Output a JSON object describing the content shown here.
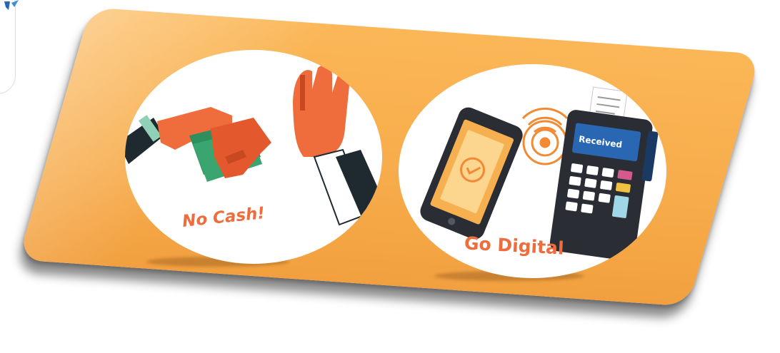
{
  "panels": {
    "left": {
      "caption": "No Cash!"
    },
    "right": {
      "caption": "Go Digital",
      "terminal_screen_text": "Received"
    }
  },
  "colors": {
    "card": "#f7ab4a",
    "accent_orange": "#ef6d3c",
    "cash_green": "#2f8e5e",
    "terminal": "#2b2d34",
    "screen_blue": "#2a67b2"
  },
  "icons": [
    "handshake-icon",
    "cash-icon",
    "stop-hand-icon",
    "smartphone-icon",
    "nfc-waves-icon",
    "payment-terminal-icon",
    "check-badge-icon"
  ]
}
